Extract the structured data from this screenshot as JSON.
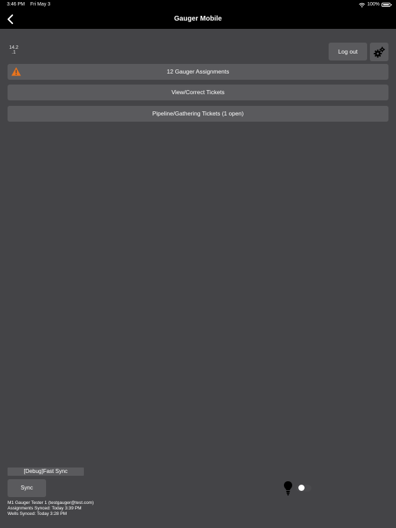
{
  "status_bar": {
    "time": "3:46 PM",
    "date": "Fri May 3",
    "battery": "100%"
  },
  "nav": {
    "title": "Gauger Mobile",
    "back_icon": "chevron-left-icon"
  },
  "version": {
    "line1": "14.2",
    "line2": ".1"
  },
  "header_actions": {
    "logout_label": "Log out",
    "settings_icon": "gears-icon"
  },
  "menu": {
    "assignments_label": "12 Gauger Assignments",
    "assignments_icon": "warning-triangle-icon",
    "view_label": "View/Correct Tickets",
    "pipeline_label": "Pipeline/Gathering Tickets (1 open)"
  },
  "footer": {
    "debug_label": "[Debug]Fast Sync",
    "sync_label": "Sync",
    "user_line": "M1 Gauger Tester 1 (testgauger@test.com)",
    "assignments_synced": "Assignments Synced: Today 3:39 PM",
    "wells_synced": "Wells Synced: Today 3:28 PM",
    "bulb_icon": "lightbulb-icon",
    "toggle_on": false
  },
  "colors": {
    "background": "#444447",
    "button": "#5a5a5d",
    "bar": "#000000",
    "warning": "#e8741e"
  }
}
